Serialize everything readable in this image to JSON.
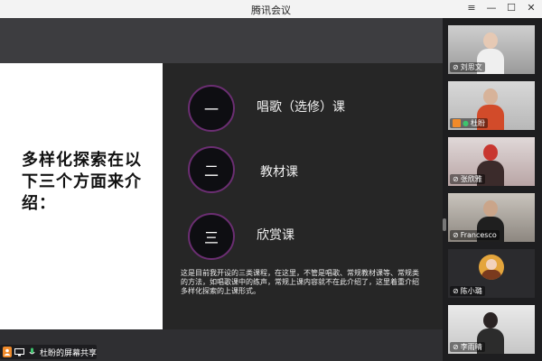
{
  "window": {
    "title": "腾讯会议",
    "icons": [
      "menu-icon",
      "minimize-icon",
      "maximize-icon",
      "close-icon"
    ]
  },
  "slide": {
    "heading": "多样化探索在以下三个方面来介绍：",
    "items": [
      {
        "numeral": "一",
        "label": "唱歌（选修）课"
      },
      {
        "numeral": "二",
        "label": "教材课"
      },
      {
        "numeral": "三",
        "label": "欣赏课"
      }
    ],
    "description": "这是目前我开设的三类课程，在这里，不管是唱歌、常规教材课等、常规类的方法，如唱歌课中的练声，常规上课内容就不在此介绍了，这里着重介绍多样化探索的上课形式。",
    "colors": {
      "left_bg": "#ffffff",
      "right_bg": "#262626",
      "circle_border": "#6b2e72"
    }
  },
  "share_status": {
    "label": "杜盼的屏幕共享",
    "icons": [
      "user-icon",
      "screen-share-icon",
      "mic-icon"
    ]
  },
  "participants": [
    {
      "name": "刘思文",
      "mic": "muted"
    },
    {
      "name": "杜盼",
      "mic": "active",
      "badge": "host"
    },
    {
      "name": "张欣雅",
      "mic": "muted"
    },
    {
      "name": "Francesco",
      "mic": "muted"
    },
    {
      "name": "陈小璐",
      "mic": "muted"
    },
    {
      "name": "李雨晴",
      "mic": "muted"
    }
  ]
}
